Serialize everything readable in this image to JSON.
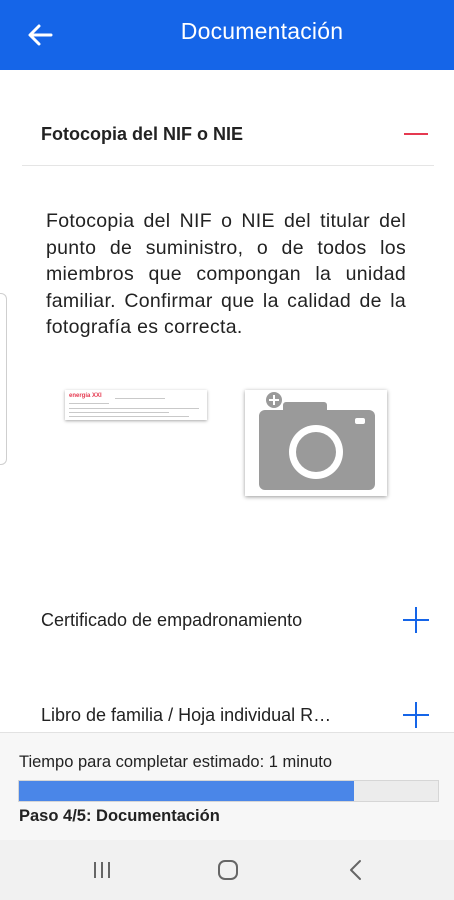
{
  "header": {
    "title": "Documentación",
    "back_icon": "arrow-left-icon"
  },
  "sections": [
    {
      "title": "Fotocopia del NIF o NIE",
      "state": "expanded",
      "icon": "minus-icon",
      "description": "Fotocopia del NIF o NIE del titular del punto de suministro, o de todos los miembros que compongan la unidad familiar. Confirmar que la calidad de la fotografía es correcta.",
      "thumbnail_logo": "energía XXI",
      "add_photo_icon": "camera-icon"
    },
    {
      "title": "Certificado de empadronamiento",
      "state": "collapsed",
      "icon": "plus-icon"
    },
    {
      "title": "Libro de familia / Hoja individual R…",
      "state": "collapsed",
      "icon": "plus-icon"
    }
  ],
  "footer": {
    "estimate_text": "Tiempo para completar estimado: 1 minuto",
    "progress_fraction": 0.8,
    "step_text": "Paso 4/5: Documentación"
  },
  "system_nav": {
    "recents_icon": "recents-icon",
    "home_icon": "home-icon",
    "back_icon": "back-chevron-icon"
  },
  "colors": {
    "primary": "#1565e8",
    "accent_red": "#e53950",
    "progress_fill": "#4a86e8"
  }
}
